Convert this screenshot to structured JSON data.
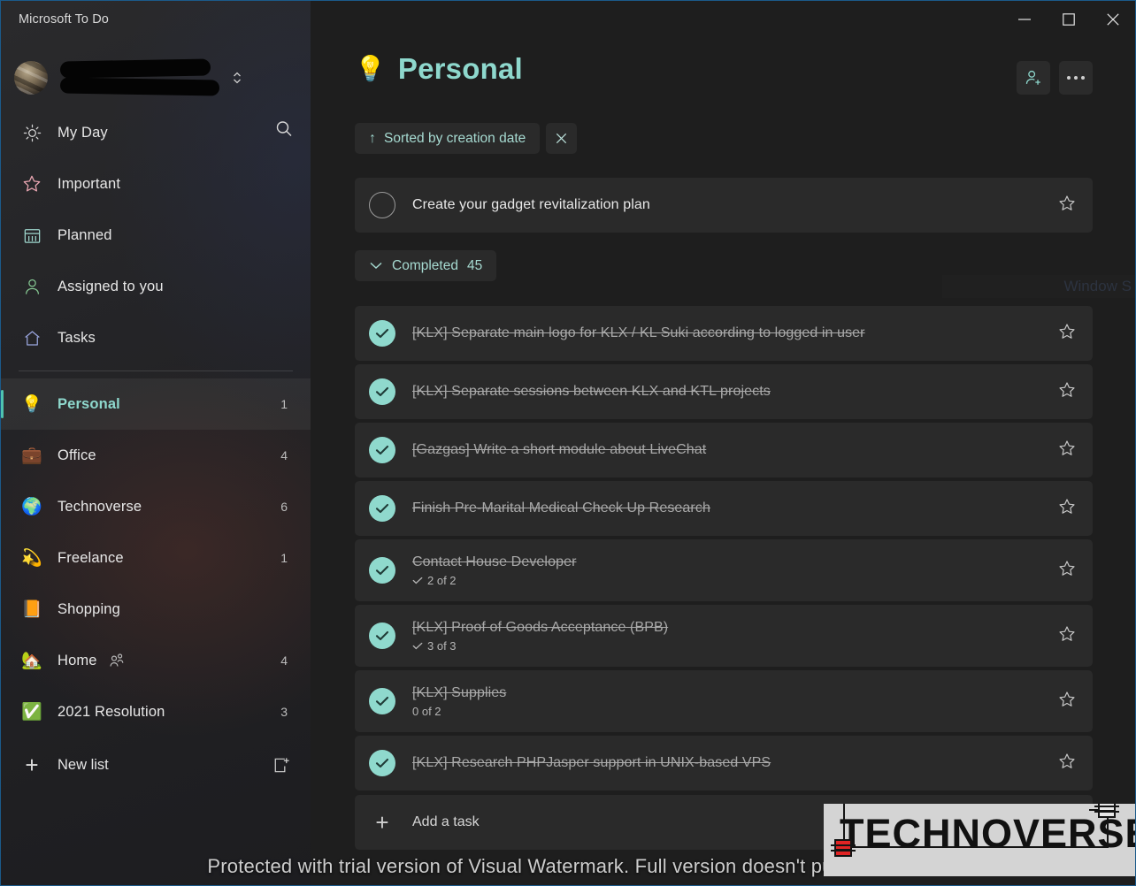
{
  "window": {
    "app_title": "Microsoft To Do",
    "controls": {
      "minimize": "—",
      "maximize": "☐",
      "close": "✕"
    }
  },
  "sidebar": {
    "account": {
      "name_redacted": "",
      "email_redacted": "",
      "avatar_name": "user-avatar"
    },
    "search_placeholder": "Search",
    "smart_lists": [
      {
        "label": "My Day",
        "icon": "sun-icon",
        "count": ""
      },
      {
        "label": "Important",
        "icon": "star-icon",
        "count": ""
      },
      {
        "label": "Planned",
        "icon": "calendar-icon",
        "count": ""
      },
      {
        "label": "Assigned to you",
        "icon": "person-icon",
        "count": ""
      },
      {
        "label": "Tasks",
        "icon": "home-icon",
        "count": ""
      }
    ],
    "custom_lists": [
      {
        "label": "Personal",
        "emoji": "💡",
        "count": "1",
        "selected": true,
        "shared": false
      },
      {
        "label": "Office",
        "emoji": "💼",
        "count": "4",
        "selected": false,
        "shared": false
      },
      {
        "label": "Technoverse",
        "emoji": "🌍",
        "count": "6",
        "selected": false,
        "shared": false
      },
      {
        "label": "Freelance",
        "emoji": "💫",
        "count": "1",
        "selected": false,
        "shared": false
      },
      {
        "label": "Shopping",
        "emoji": "📙",
        "count": "",
        "selected": false,
        "shared": false
      },
      {
        "label": "Home",
        "emoji": "🏡",
        "count": "4",
        "selected": false,
        "shared": true
      },
      {
        "label": "2021 Resolution",
        "emoji": "✅",
        "count": "3",
        "selected": false,
        "shared": false
      }
    ],
    "new_list_label": "New list",
    "new_group_icon": "new-group-icon"
  },
  "main": {
    "list_emoji": "💡",
    "list_title": "Personal",
    "add_member_icon": "person-add-icon",
    "more_options_icon": "more-options-icon",
    "sort": {
      "arrow": "↑",
      "label": "Sorted by creation date",
      "close_icon": "close-icon"
    },
    "open_tasks": [
      {
        "title": "Create your gadget revitalization plan",
        "done": false,
        "starred": false,
        "subtasks": ""
      }
    ],
    "completed_section": {
      "label": "Completed",
      "count": "45",
      "expanded": true
    },
    "completed_tasks": [
      {
        "title": "[KLX] Separate main logo for KLX / KL Suki according to logged in user",
        "done": true,
        "starred": false,
        "subtasks": ""
      },
      {
        "title": "[KLX] Separate sessions between KLX and KTL projects",
        "done": true,
        "starred": false,
        "subtasks": ""
      },
      {
        "title": "[Gazgas] Write a short module about LiveChat",
        "done": true,
        "starred": false,
        "subtasks": ""
      },
      {
        "title": "Finish Pre-Marital Medical Check Up Research",
        "done": true,
        "starred": false,
        "subtasks": ""
      },
      {
        "title": "Contact House Developer",
        "done": true,
        "starred": false,
        "subtasks": "2 of 2",
        "subtask_check": true
      },
      {
        "title": "[KLX] Proof of Goods Acceptance (BPB)",
        "done": true,
        "starred": false,
        "subtasks": "3 of 3",
        "subtask_check": true
      },
      {
        "title": "[KLX] Supplies",
        "done": true,
        "starred": false,
        "subtasks": "0 of 2",
        "subtask_check": false
      },
      {
        "title": "[KLX] Research PHPJasper support in UNIX-based VPS",
        "done": true,
        "starred": false,
        "subtasks": ""
      }
    ],
    "add_task_label": "Add a task"
  },
  "overlays": {
    "windows_activation_partial": "Window S",
    "watermark_text": "Protected with trial version of Visual Watermark. Full version doesn't put this mark.",
    "watermark_logo_word": "TECHNOVERSE"
  },
  "colors": {
    "accent_teal": "#8ed8cd",
    "sidebar_bg": "#232326",
    "main_bg": "#1e1e1e",
    "task_bg": "#2a2a2a",
    "check_fill": "#8fd9cd"
  }
}
